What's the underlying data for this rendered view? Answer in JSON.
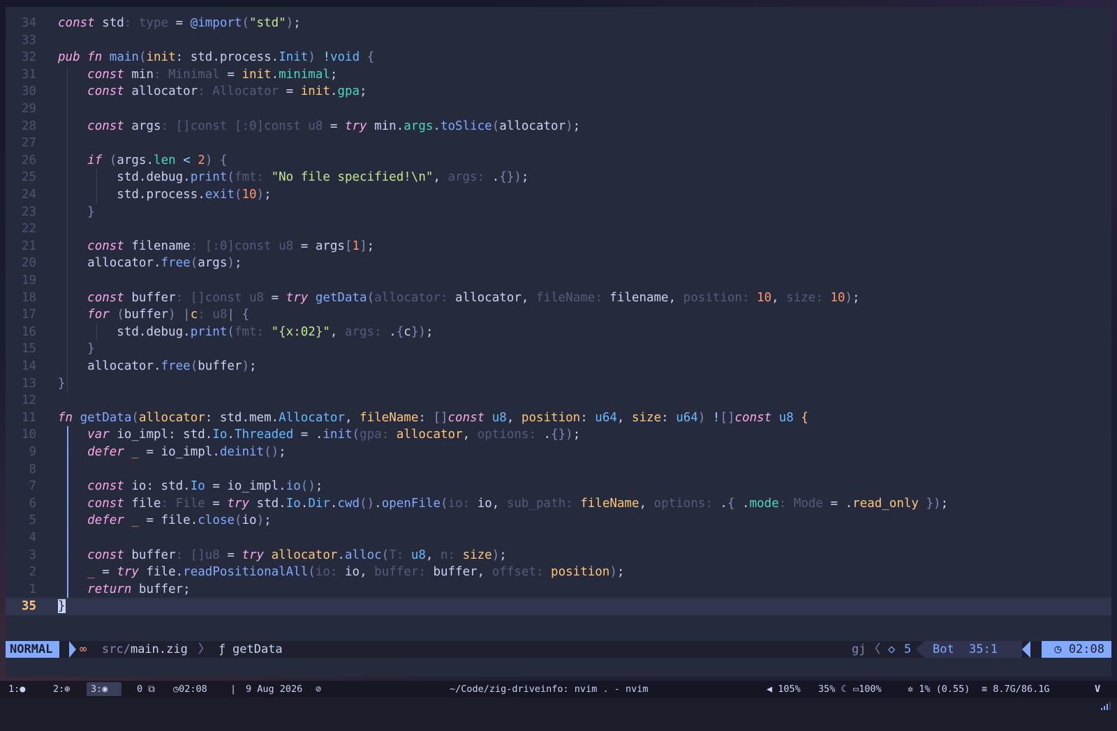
{
  "editor": {
    "lines": [
      {
        "num": "34",
        "html": "<span class='k'>const</span> <span class='d'>std</span><span class='h'>: type</span> = <span class='bi'>@import</span><span class='br'>(</span><span class='s'>\"std\"</span><span class='br'>)</span>;"
      },
      {
        "num": "33",
        "html": ""
      },
      {
        "num": "32",
        "html": "<span class='k'>pub</span> <span class='k'>fn</span> <span class='f'>main</span><span class='br'>(</span><span class='p'>init</span>: <span class='d'>std</span>.<span class='d'>process</span>.<span class='t'>Init</span><span class='br'>)</span> <span class='o'>!</span><span class='t'>void</span> <span class='br'>{</span>"
      },
      {
        "num": "31",
        "html": "    <span class='k'>const</span> <span class='d'>min</span><span class='h'>: Minimal</span> = <span class='p'>init</span>.<span class='pr'>minimal</span>;"
      },
      {
        "num": "30",
        "html": "    <span class='k'>const</span> <span class='d'>allocator</span><span class='h'>: Allocator</span> = <span class='p'>init</span>.<span class='pr'>gpa</span>;"
      },
      {
        "num": "29",
        "html": ""
      },
      {
        "num": "28",
        "html": "    <span class='k'>const</span> <span class='d'>args</span><span class='h'>: []const [:0]const u8</span> = <span class='k'>try</span> <span class='d'>min</span>.<span class='pr'>args</span>.<span class='f'>toSlice</span><span class='br'>(</span><span class='d'>allocator</span><span class='br'>)</span>;"
      },
      {
        "num": "27",
        "html": ""
      },
      {
        "num": "26",
        "html": "    <span class='k'>if</span> <span class='br'>(</span><span class='d'>args</span>.<span class='pr'>len</span> <span class='o'>&lt;</span> <span class='n'>2</span><span class='br'>)</span> <span class='br'>{</span>"
      },
      {
        "num": "25",
        "html": "        <span class='d'>std</span>.<span class='d'>debug</span>.<span class='f'>print</span><span class='br'>(</span><span class='h'>fmt: </span><span class='s'>\"No file specified!\\n\"</span>, <span class='h'>args: </span>.<span class='br'>{}</span><span class='br'>)</span>;"
      },
      {
        "num": "24",
        "html": "        <span class='d'>std</span>.<span class='d'>process</span>.<span class='f'>exit</span><span class='br'>(</span><span class='n'>10</span><span class='br'>)</span>;"
      },
      {
        "num": "23",
        "html": "    <span class='br'>}</span>"
      },
      {
        "num": "22",
        "html": ""
      },
      {
        "num": "21",
        "html": "    <span class='k'>const</span> <span class='d'>filename</span><span class='h'>: [:0]const u8</span> = <span class='d'>args</span><span class='br'>[</span><span class='n'>1</span><span class='br'>]</span>;"
      },
      {
        "num": "20",
        "html": "    <span class='d'>allocator</span>.<span class='f'>free</span><span class='br'>(</span><span class='d'>args</span><span class='br'>)</span>;"
      },
      {
        "num": "19",
        "html": ""
      },
      {
        "num": "18",
        "html": "    <span class='k'>const</span> <span class='d'>buffer</span><span class='h'>: []const u8</span> = <span class='k'>try</span> <span class='f'>getData</span><span class='br'>(</span><span class='h'>allocator: </span><span class='d'>allocator</span>, <span class='h'>fileName: </span><span class='d'>filename</span>, <span class='h'>position: </span><span class='n'>10</span>, <span class='h'>size: </span><span class='n'>10</span><span class='br'>)</span>;"
      },
      {
        "num": "17",
        "html": "    <span class='k'>for</span> <span class='br'>(</span><span class='d'>buffer</span><span class='br'>)</span> <span class='br'>|</span><span class='p'>c</span><span class='h'>: u8</span><span class='br'>|</span> <span class='br'>{</span>"
      },
      {
        "num": "16",
        "html": "        <span class='d'>std</span>.<span class='d'>debug</span>.<span class='f'>print</span><span class='br'>(</span><span class='h'>fmt: </span><span class='s'>\"{x:02}\"</span>, <span class='h'>args: </span>.<span class='br'>{</span><span class='d'>c</span><span class='br'>}</span><span class='br'>)</span>;"
      },
      {
        "num": "15",
        "html": "    <span class='br'>}</span>"
      },
      {
        "num": "14",
        "html": "    <span class='d'>allocator</span>.<span class='f'>free</span><span class='br'>(</span><span class='d'>buffer</span><span class='br'>)</span>;"
      },
      {
        "num": "13",
        "html": "<span class='br'>}</span>"
      },
      {
        "num": "12",
        "html": ""
      },
      {
        "num": "11",
        "html": "<span class='k'>fn</span> <span class='f'>getData</span><span class='br'>(</span><span class='p'>allocator</span>: <span class='d'>std</span>.<span class='d'>mem</span>.<span class='t'>Allocator</span>, <span class='p'>fileName</span>: <span class='br'>[]</span><span class='k'>const</span> <span class='t'>u8</span>, <span class='p'>position</span>: <span class='t'>u64</span>, <span class='p'>size</span>: <span class='t'>u64</span><span class='br'>)</span> <span class='o'>!</span><span class='br'>[]</span><span class='k'>const</span> <span class='t'>u8</span> <span class='p'>{</span>"
      },
      {
        "num": "10",
        "html": "    <span class='k'>var</span> <span class='d'>io_impl</span>: <span class='d'>std</span>.<span class='t'>Io</span>.<span class='t'>Threaded</span> = .<span class='f'>init</span><span class='br'>(</span><span class='h'>gpa: </span><span class='p'>allocator</span>, <span class='h'>options: </span>.<span class='br'>{}</span><span class='br'>)</span>;"
      },
      {
        "num": "9",
        "html": "    <span class='k'>defer</span> <span class='n'>_</span> = <span class='d'>io_impl</span>.<span class='f'>deinit</span><span class='br'>()</span>;"
      },
      {
        "num": "8",
        "html": ""
      },
      {
        "num": "7",
        "html": "    <span class='k'>const</span> <span class='d'>io</span>: <span class='d'>std</span>.<span class='t'>Io</span> = <span class='d'>io_impl</span>.<span class='f'>io</span><span class='br'>()</span>;"
      },
      {
        "num": "6",
        "html": "    <span class='k'>const</span> <span class='d'>file</span><span class='h'>: File</span> = <span class='k'>try</span> <span class='d'>std</span>.<span class='t'>Io</span>.<span class='t'>Dir</span>.<span class='f'>cwd</span><span class='br'>()</span>.<span class='f'>openFile</span><span class='br'>(</span><span class='h'>io: </span><span class='d'>io</span>, <span class='h'>sub_path: </span><span class='p'>fileName</span>, <span class='h'>options: </span>.<span class='br'>{</span> .<span class='pr'>mode</span><span class='h'>: Mode</span> = .<span class='p'>read_only</span> <span class='br'>}</span><span class='br'>)</span>;"
      },
      {
        "num": "5",
        "html": "    <span class='k'>defer</span> <span class='n'>_</span> = <span class='d'>file</span>.<span class='f'>close</span><span class='br'>(</span><span class='d'>io</span><span class='br'>)</span>;"
      },
      {
        "num": "4",
        "html": ""
      },
      {
        "num": "3",
        "html": "    <span class='k'>const</span> <span class='d'>buffer</span><span class='h'>: []u8</span> = <span class='k'>try</span> <span class='p'>allocator</span>.<span class='f'>alloc</span><span class='br'>(</span><span class='h'>T: </span><span class='t'>u8</span>, <span class='h'>n: </span><span class='p'>size</span><span class='br'>)</span>;"
      },
      {
        "num": "2",
        "html": "    <span class='n'>_</span> = <span class='k'>try</span> <span class='d'>file</span>.<span class='f'>readPositionalAll</span><span class='br'>(</span><span class='h'>io: </span><span class='d'>io</span>, <span class='h'>buffer: </span><span class='d'>buffer</span>, <span class='h'>offset: </span><span class='p'>position</span><span class='br'>)</span>;"
      },
      {
        "num": "1",
        "html": "    <span class='k'>return</span> <span class='d'>buffer</span>;"
      },
      {
        "num": "35",
        "html": "<span class='cursor'>}</span>",
        "current": true
      }
    ]
  },
  "statusline": {
    "mode": "NORMAL",
    "file_icon": "∞",
    "path_dir": "src/",
    "path_file": "main.zig",
    "breadcrumb_sep": "〉",
    "func_icon": "ƒ",
    "func_name": "getData",
    "pending_keys": "gj",
    "chev": "〈",
    "lsp_icon": "◇",
    "lsp_count": "5",
    "scroll": "Bot",
    "cursor_pos": "35:1",
    "clock_icon": "◷",
    "clock": "02:08"
  },
  "bar": {
    "ws1": "1:",
    "ws1_icon": "●",
    "ws2": "2:",
    "ws2_icon": "⊕",
    "ws3": "3:",
    "ws3_icon": "◉",
    "ws_extra": "0",
    "ws_extra_icon": "⧉",
    "time_icon": "◷",
    "time": "02:08",
    "sep": "|",
    "date": "9 Aug 2026",
    "idle_icon": "⊘",
    "title": "~/Code/zig-driveinfo: nvim . - nvim",
    "volume_icon": "◀",
    "volume": "105%",
    "brightness": "35%",
    "moon_icon": "☾",
    "battery_icon": "▭",
    "battery": "100%",
    "cpu_icon": "✲",
    "cpu": "1% (0.55)",
    "mem_icon": "≡",
    "mem": "8.7G/86.1G",
    "tray_icon": "V"
  }
}
